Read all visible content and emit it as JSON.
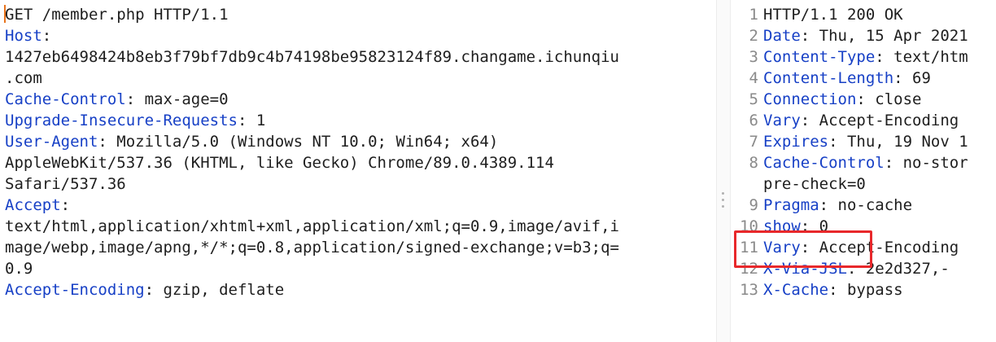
{
  "request": {
    "lines": [
      {
        "k": "",
        "v": "GET /member.php HTTP/1.1"
      },
      {
        "k": "Host",
        "v": ":"
      },
      {
        "k": "",
        "v": "1427eb6498424b8eb3f79bf7db9c4b74198be95823124f89.changame.ichunqiu"
      },
      {
        "k": "",
        "v": ".com"
      },
      {
        "k": "Cache-Control",
        "v": ": max-age=0"
      },
      {
        "k": "Upgrade-Insecure-Requests",
        "v": ": 1"
      },
      {
        "k": "User-Agent",
        "v": ": Mozilla/5.0 (Windows NT 10.0; Win64; x64)"
      },
      {
        "k": "",
        "v": "AppleWebKit/537.36 (KHTML, like Gecko) Chrome/89.0.4389.114"
      },
      {
        "k": "",
        "v": "Safari/537.36"
      },
      {
        "k": "Accept",
        "v": ":"
      },
      {
        "k": "",
        "v": "text/html,application/xhtml+xml,application/xml;q=0.9,image/avif,i"
      },
      {
        "k": "",
        "v": "mage/webp,image/apng,*/*;q=0.8,application/signed-exchange;v=b3;q="
      },
      {
        "k": "",
        "v": "0.9"
      },
      {
        "k": "",
        "v": ""
      },
      {
        "k": "Accept-Encoding",
        "v": ": gzip, deflate"
      }
    ]
  },
  "response": {
    "lines": [
      {
        "n": "1",
        "k": "",
        "v": "HTTP/1.1 200 OK"
      },
      {
        "n": "2",
        "k": "Date",
        "v": ": Thu, 15 Apr 2021"
      },
      {
        "n": "3",
        "k": "Content-Type",
        "v": ": text/htm"
      },
      {
        "n": "4",
        "k": "Content-Length",
        "v": ": 69"
      },
      {
        "n": "5",
        "k": "Connection",
        "v": ": close"
      },
      {
        "n": "6",
        "k": "Vary",
        "v": ": Accept-Encoding"
      },
      {
        "n": "7",
        "k": "Expires",
        "v": ": Thu, 19 Nov 1"
      },
      {
        "n": "8",
        "k": "Cache-Control",
        "v": ": no-stor"
      },
      {
        "n": "",
        "k": "",
        "v": "pre-check=0"
      },
      {
        "n": "9",
        "k": "Pragma",
        "v": ": no-cache"
      },
      {
        "n": "10",
        "k": "show",
        "v": ": 0"
      },
      {
        "n": "11",
        "k": "Vary",
        "v": ": Accept-Encoding"
      },
      {
        "n": "12",
        "k": "X-Via-JSL",
        "v": ": 2e2d327,-"
      },
      {
        "n": "13",
        "k": "X-Cache",
        "v": ": bypass"
      }
    ]
  }
}
